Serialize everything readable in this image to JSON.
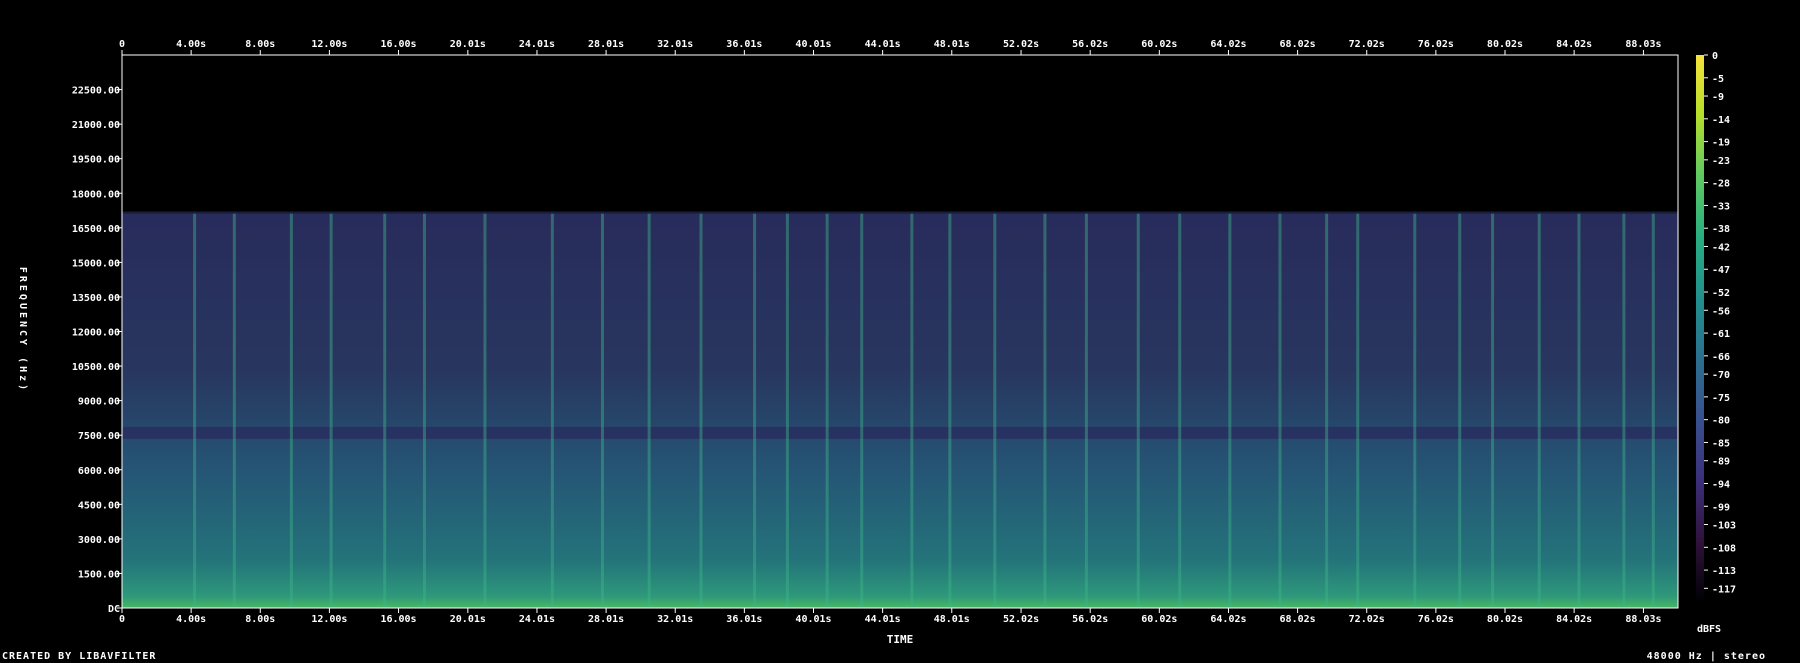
{
  "chart_data": {
    "type": "heatmap",
    "xlabel": "TIME",
    "ylabel": "FREQUENCY (Hz)",
    "x_ticks": [
      "0",
      "4.00s",
      "8.00s",
      "12.00s",
      "16.00s",
      "20.01s",
      "24.01s",
      "28.01s",
      "32.01s",
      "36.01s",
      "40.01s",
      "44.01s",
      "48.01s",
      "52.02s",
      "56.02s",
      "60.02s",
      "64.02s",
      "68.02s",
      "72.02s",
      "76.02s",
      "80.02s",
      "84.02s",
      "88.03s"
    ],
    "x_tick_values": [
      0,
      4.0,
      8.0,
      12.0,
      16.0,
      20.01,
      24.01,
      28.01,
      32.01,
      36.01,
      40.01,
      44.01,
      48.01,
      52.02,
      56.02,
      60.02,
      64.02,
      68.02,
      72.02,
      76.02,
      80.02,
      84.02,
      88.03
    ],
    "xlim": [
      0,
      90.03
    ],
    "y_ticks": [
      "DC",
      "1500.00",
      "3000.00",
      "4500.00",
      "6000.00",
      "7500.00",
      "9000.00",
      "10500.00",
      "12000.00",
      "13500.00",
      "15000.00",
      "16500.00",
      "18000.00",
      "19500.00",
      "21000.00",
      "22500.00"
    ],
    "y_tick_values": [
      0,
      1500,
      3000,
      4500,
      6000,
      7500,
      9000,
      10500,
      12000,
      13500,
      15000,
      16500,
      18000,
      19500,
      21000,
      22500
    ],
    "ylim": [
      0,
      24000
    ],
    "colorbar": {
      "label": "dBFS",
      "ticks": [
        "0",
        "-5",
        "-9",
        "-14",
        "-19",
        "-23",
        "-28",
        "-33",
        "-38",
        "-42",
        "-47",
        "-52",
        "-56",
        "-61",
        "-66",
        "-70",
        "-75",
        "-80",
        "-85",
        "-89",
        "-94",
        "-99",
        "-103",
        "-108",
        "-113",
        "-117"
      ],
      "range": [
        -120,
        0
      ],
      "colors": [
        "#000004",
        "#30123b",
        "#3b2f7a",
        "#39508f",
        "#2b6f8e",
        "#21908c",
        "#28ae80",
        "#5ec962",
        "#b5de2b",
        "#f5e33a"
      ]
    },
    "cutoff_hz": 17200,
    "tone_bands": [
      {
        "freq_hz": 7600,
        "level": "low"
      }
    ],
    "transients_s": [
      4.2,
      6.5,
      9.8,
      12.1,
      15.2,
      17.5,
      21.0,
      24.9,
      27.8,
      30.5,
      33.5,
      36.6,
      38.5,
      40.8,
      42.8,
      45.7,
      47.9,
      50.5,
      53.4,
      55.8,
      58.8,
      61.2,
      64.1,
      67.0,
      69.7,
      71.5,
      74.8,
      77.4,
      79.3,
      82.0,
      84.3,
      86.9,
      88.6
    ]
  },
  "footer": {
    "credit": "CREATED BY LIBAVFILTER",
    "format": "48000 Hz | stereo"
  }
}
